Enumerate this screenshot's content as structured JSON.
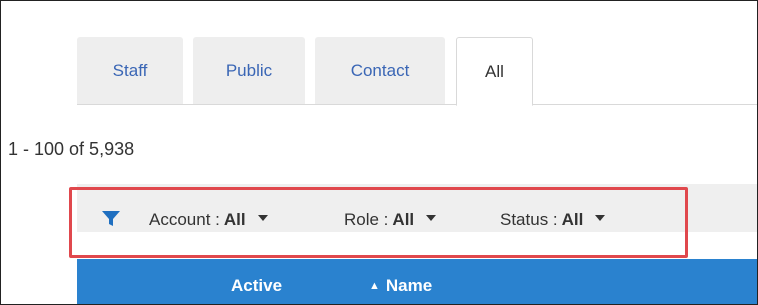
{
  "tabs": [
    {
      "label": "Staff",
      "active": false
    },
    {
      "label": "Public",
      "active": false
    },
    {
      "label": "Contact",
      "active": false
    },
    {
      "label": "All",
      "active": true
    }
  ],
  "results": {
    "count_text": "1 - 100 of 5,938"
  },
  "filters": {
    "icon": "filter-icon",
    "account": {
      "label": "Account :",
      "value": "All"
    },
    "role": {
      "label": "Role :",
      "value": "All"
    },
    "status": {
      "label": "Status :",
      "value": "All"
    }
  },
  "table": {
    "columns": [
      {
        "label": "Active"
      },
      {
        "label": "Name",
        "sort": "ascending",
        "sort_glyph": "▲"
      }
    ]
  },
  "colors": {
    "accent": "#2a82cf",
    "highlight": "#e0484d",
    "tab_text": "#3a66b5"
  }
}
